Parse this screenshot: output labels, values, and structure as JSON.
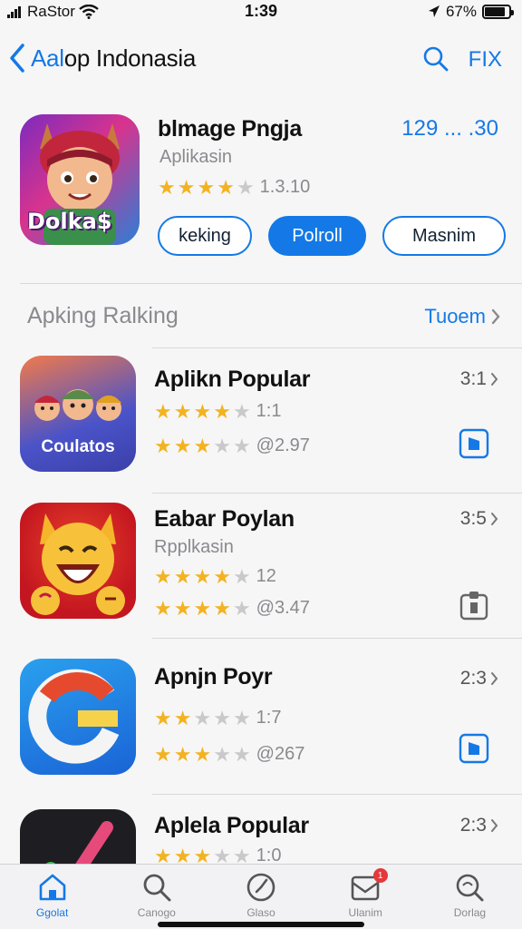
{
  "status_bar": {
    "carrier": "RaStor",
    "time": "1:39",
    "battery": "67%",
    "battery_level": 0.85
  },
  "nav": {
    "back_label_blue": "Aal",
    "back_label_black": "op Indonasia",
    "action_label": "FIX"
  },
  "featured": {
    "title": "blmage Pngja",
    "subtitle": "Aplikasin",
    "rating_stars": 4,
    "rating_text": "1.3.10",
    "price": "129 ... .30",
    "icon_text": "Dolka$",
    "buttons": [
      "keking",
      "Polroll",
      "Masnim"
    ]
  },
  "section": {
    "title": "Apking Ralking",
    "link": "Tuoem"
  },
  "apps": [
    {
      "name": "Aplikn Popular",
      "subtitle": "",
      "rating1_stars": 4,
      "rating1_text": "1:1",
      "rating2_stars": 3,
      "rating2_text": "@2.97",
      "meta": "3:1",
      "icon_text": "Coulatos",
      "icon_name": "characters-app-icon"
    },
    {
      "name": "Eabar Poylan",
      "subtitle": "Rpplkasin",
      "rating1_stars": 4,
      "rating1_text": "12",
      "rating2_stars": 4,
      "rating2_text": "@3.47",
      "meta": "3:5",
      "icon_text": "",
      "icon_name": "emoji-fox-app-icon"
    },
    {
      "name": "Apnjn Poyr",
      "subtitle": "",
      "rating1_stars": 2,
      "rating1_text": "1:7",
      "rating2_stars": 3,
      "rating2_text": "@267",
      "meta": "2:3",
      "icon_text": "",
      "icon_name": "g-logo-app-icon"
    },
    {
      "name": "Aplela Popular",
      "subtitle": "",
      "rating1_stars": 3,
      "rating1_text": "1:0",
      "meta": "2:3",
      "icon_text": "",
      "icon_name": "pen-app-icon"
    }
  ],
  "tabs": [
    {
      "label": "Ggolat",
      "icon": "home-icon",
      "active": true
    },
    {
      "label": "Canogo",
      "icon": "search-icon",
      "active": false
    },
    {
      "label": "Glaso",
      "icon": "clock-icon",
      "active": false
    },
    {
      "label": "Ulanim",
      "icon": "inbox-icon",
      "active": false,
      "badge": "1"
    },
    {
      "label": "Dorlag",
      "icon": "magnify-icon",
      "active": false
    }
  ],
  "colors": {
    "accent": "#1479e6",
    "star": "#f3b321",
    "badge": "#e5383b"
  }
}
